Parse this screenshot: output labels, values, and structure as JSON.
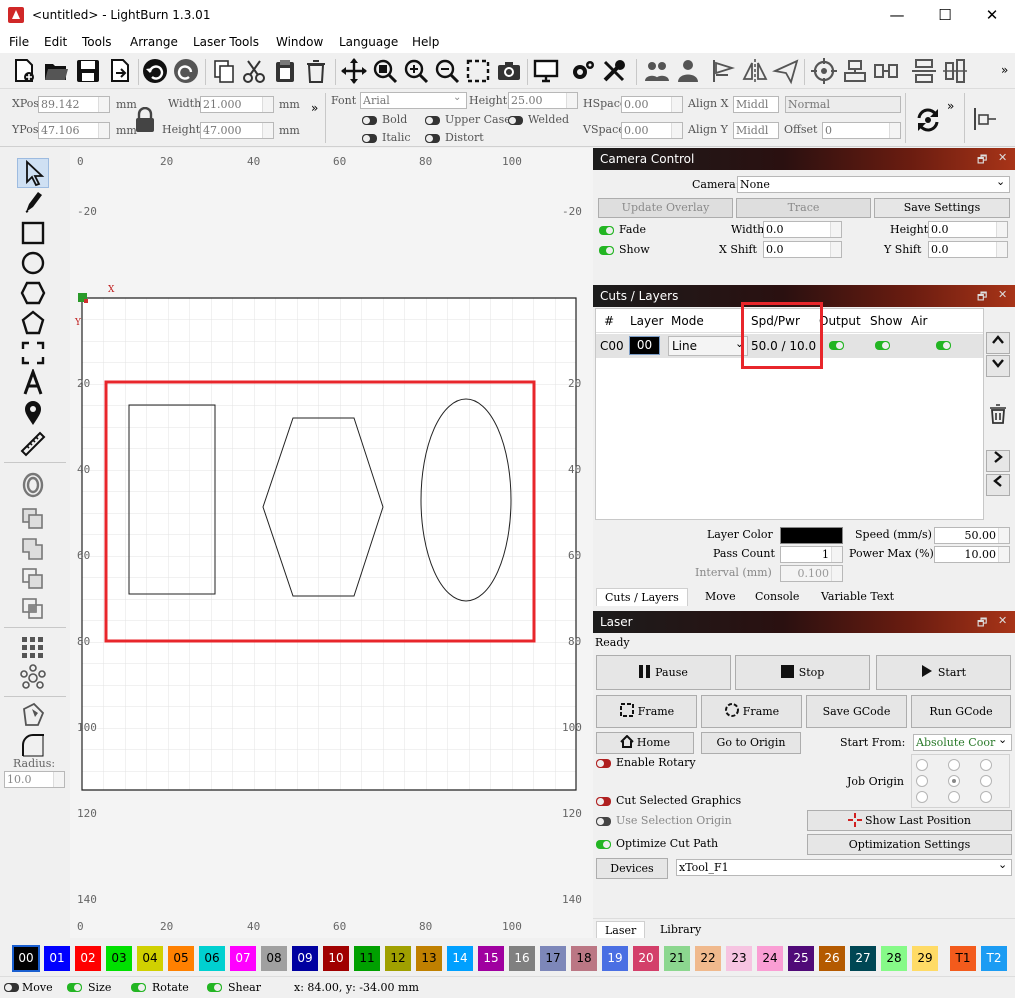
{
  "window": {
    "title": "<untitled> - LightBurn 1.3.01"
  },
  "menu": [
    "File",
    "Edit",
    "Tools",
    "Arrange",
    "Laser Tools",
    "Window",
    "Language",
    "Help"
  ],
  "numeric_toolbar": {
    "xpos_label": "XPos",
    "xpos": "89.142",
    "ypos_label": "YPos",
    "ypos": "47.106",
    "unit": "mm",
    "width_label": "Width",
    "width": "21.000",
    "height_label": "Height",
    "height": "47.000"
  },
  "text_toolbar": {
    "font_label": "Font",
    "font": "Arial",
    "height_label": "Height",
    "height": "25.00",
    "hspace_label": "HSpace",
    "hspace": "0.00",
    "vspace_label": "VSpace",
    "vspace": "0.00",
    "alignx_label": "Align X",
    "alignx": "Middl",
    "aligny_label": "Align Y",
    "aligny": "Middl",
    "style": "Normal",
    "offset_label": "Offset",
    "offset": "0",
    "bold": "Bold",
    "italic": "Italic",
    "upper": "Upper Case",
    "distort": "Distort",
    "welded": "Welded"
  },
  "left_tools": {
    "radius_label": "Radius:",
    "radius": "10.0"
  },
  "ruler": {
    "top": [
      "0",
      "20",
      "40",
      "60",
      "80",
      "100"
    ],
    "bottom": [
      "0",
      "20",
      "40",
      "60",
      "80",
      "100"
    ],
    "left": [
      "-20",
      "20",
      "40",
      "60",
      "80",
      "100",
      "120",
      "140"
    ],
    "right": [
      "-20",
      "20",
      "40",
      "60",
      "80",
      "100",
      "120",
      "140"
    ],
    "axis_x": "X",
    "axis_y": "Y"
  },
  "camera": {
    "title": "Camera Control",
    "camera_label": "Camera:",
    "camera_value": "None",
    "update_overlay": "Update Overlay",
    "trace": "Trace",
    "save_settings": "Save Settings",
    "fade": "Fade",
    "show": "Show",
    "width_label": "Width",
    "width": "0.0",
    "height_label": "Height",
    "height": "0.0",
    "xshift_label": "X Shift",
    "xshift": "0.0",
    "yshift_label": "Y Shift",
    "yshift": "0.0"
  },
  "cuts": {
    "title": "Cuts / Layers",
    "headers": [
      "#",
      "Layer",
      "Mode",
      "Spd/Pwr",
      "Output",
      "Show",
      "Air"
    ],
    "row": {
      "num": "C00",
      "layer": "00",
      "mode": "Line",
      "spdpwr": "50.0 / 10.0"
    },
    "layer_color_label": "Layer Color",
    "speed_label": "Speed (mm/s)",
    "speed": "50.00",
    "pass_count_label": "Pass Count",
    "pass_count": "1",
    "power_max_label": "Power Max (%)",
    "power_max": "10.00",
    "interval_label": "Interval (mm)",
    "interval": "0.100"
  },
  "tabs": [
    "Cuts / Layers",
    "Move",
    "Console",
    "Variable Text"
  ],
  "laser": {
    "title": "Laser",
    "status": "Ready",
    "pause": "Pause",
    "stop": "Stop",
    "start": "Start",
    "frame1": "Frame",
    "frame2": "Frame",
    "save_gcode": "Save GCode",
    "run_gcode": "Run GCode",
    "home": "Home",
    "go_origin": "Go to Origin",
    "start_from_label": "Start From:",
    "start_from": "Absolute Coor",
    "enable_rotary": "Enable Rotary",
    "job_origin": "Job Origin",
    "cut_selected": "Cut Selected Graphics",
    "use_selection_origin": "Use Selection Origin",
    "show_last_position": "Show Last Position",
    "optimize_cut_path": "Optimize Cut Path",
    "optimization_settings": "Optimization Settings",
    "devices": "Devices",
    "device": "xTool_F1"
  },
  "bottom_tabs": [
    "Laser",
    "Library"
  ],
  "palette": [
    {
      "label": "00",
      "color": "#000000",
      "text": "#ffffff"
    },
    {
      "label": "01",
      "color": "#0000ff",
      "text": "#ffffff"
    },
    {
      "label": "02",
      "color": "#ff0000",
      "text": "#ffffff"
    },
    {
      "label": "03",
      "color": "#00e000",
      "text": "#000000"
    },
    {
      "label": "04",
      "color": "#d0d000",
      "text": "#000000"
    },
    {
      "label": "05",
      "color": "#ff8000",
      "text": "#000000"
    },
    {
      "label": "06",
      "color": "#00d0d0",
      "text": "#000000"
    },
    {
      "label": "07",
      "color": "#ff00ff",
      "text": "#ffffff"
    },
    {
      "label": "08",
      "color": "#a0a0a0",
      "text": "#000000"
    },
    {
      "label": "09",
      "color": "#0000a0",
      "text": "#ffffff"
    },
    {
      "label": "10",
      "color": "#a00000",
      "text": "#ffffff"
    },
    {
      "label": "11",
      "color": "#00a000",
      "text": "#000000"
    },
    {
      "label": "12",
      "color": "#a0a000",
      "text": "#000000"
    },
    {
      "label": "13",
      "color": "#c08000",
      "text": "#000000"
    },
    {
      "label": "14",
      "color": "#00a0ff",
      "text": "#ffffff"
    },
    {
      "label": "15",
      "color": "#a000a0",
      "text": "#ffffff"
    },
    {
      "label": "16",
      "color": "#808080",
      "text": "#ffffff"
    },
    {
      "label": "17",
      "color": "#7d87b9",
      "text": "#000000"
    },
    {
      "label": "18",
      "color": "#bb7784",
      "text": "#000000"
    },
    {
      "label": "19",
      "color": "#4a6fe3",
      "text": "#ffffff"
    },
    {
      "label": "20",
      "color": "#d33f6a",
      "text": "#ffffff"
    },
    {
      "label": "21",
      "color": "#8cd78f",
      "text": "#000000"
    },
    {
      "label": "22",
      "color": "#f0b98d",
      "text": "#000000"
    },
    {
      "label": "23",
      "color": "#f6c4e1",
      "text": "#000000"
    },
    {
      "label": "24",
      "color": "#fa9ed4",
      "text": "#000000"
    },
    {
      "label": "25",
      "color": "#500a78",
      "text": "#ffffff"
    },
    {
      "label": "26",
      "color": "#b45a00",
      "text": "#ffffff"
    },
    {
      "label": "27",
      "color": "#004754",
      "text": "#ffffff"
    },
    {
      "label": "28",
      "color": "#86fa88",
      "text": "#000000"
    },
    {
      "label": "29",
      "color": "#ffdb66",
      "text": "#000000"
    },
    {
      "label": "T1",
      "color": "#f35b1c",
      "text": "#000000"
    },
    {
      "label": "T2",
      "color": "#1c9cf3",
      "text": "#ffffff"
    }
  ],
  "statusbar": {
    "move": "Move",
    "size": "Size",
    "rotate": "Rotate",
    "shear": "Shear",
    "coords": "x: 84.00, y: -34.00 mm"
  },
  "colors": {
    "highlight": "#e8262b",
    "accent_green": "#23b523",
    "panel_gradient_end": "#a83418"
  }
}
